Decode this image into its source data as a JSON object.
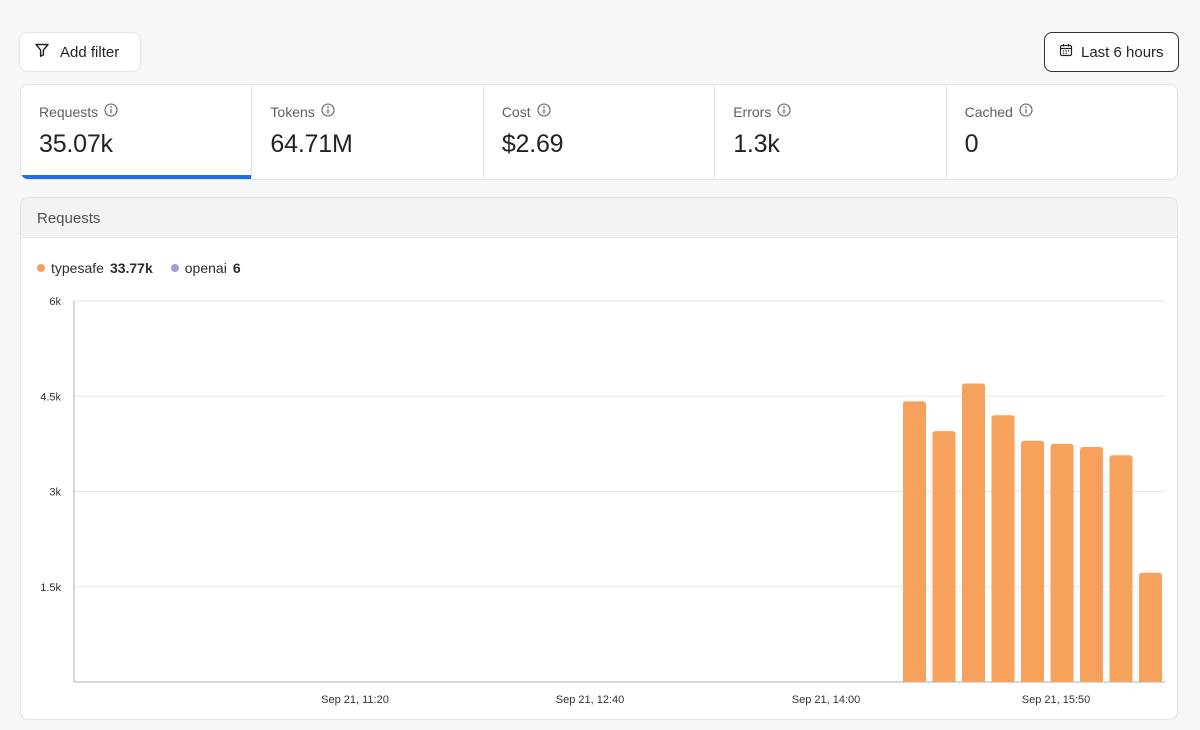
{
  "toolbar": {
    "add_filter_label": "Add filter",
    "time_range_label": "Last 6 hours"
  },
  "metrics": [
    {
      "label": "Requests",
      "value": "35.07k",
      "active": true
    },
    {
      "label": "Tokens",
      "value": "64.71M",
      "active": false
    },
    {
      "label": "Cost",
      "value": "$2.69",
      "active": false
    },
    {
      "label": "Errors",
      "value": "1.3k",
      "active": false
    },
    {
      "label": "Cached",
      "value": "0",
      "active": false
    }
  ],
  "chart_panel": {
    "title": "Requests"
  },
  "legend": [
    {
      "name": "typesafe",
      "value": "33.77k",
      "color": "#f6a15c"
    },
    {
      "name": "openai",
      "value": "6",
      "color": "#a99ad9"
    }
  ],
  "chart_data": {
    "type": "bar",
    "title": "Requests",
    "xlabel": "",
    "ylabel": "",
    "ylim": [
      0,
      6000
    ],
    "y_ticks": [
      "6k",
      "4.5k",
      "3k",
      "1.5k"
    ],
    "y_tick_values": [
      6000,
      4500,
      3000,
      1500
    ],
    "x_tick_labels": [
      "Sep 21, 11:20",
      "Sep 21, 12:40",
      "Sep 21, 14:00",
      "Sep 21, 15:50"
    ],
    "grid": true,
    "series": [
      {
        "name": "typesafe",
        "color": "#f6a15c",
        "values": [
          4420,
          3950,
          4700,
          4200,
          3800,
          3750,
          3700,
          3570,
          1720
        ]
      }
    ]
  }
}
